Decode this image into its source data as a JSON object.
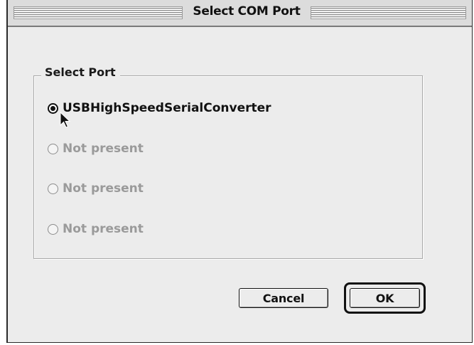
{
  "dialog": {
    "title": "Select COM Port"
  },
  "port_group": {
    "legend": "Select Port",
    "options": [
      {
        "label": "USBHighSpeedSerialConverter",
        "selected": true,
        "enabled": true
      },
      {
        "label": "Not present",
        "selected": false,
        "enabled": false
      },
      {
        "label": "Not present",
        "selected": false,
        "enabled": false
      },
      {
        "label": "Not present",
        "selected": false,
        "enabled": false
      }
    ]
  },
  "buttons": {
    "cancel_label": "Cancel",
    "ok_label": "OK"
  },
  "colors": {
    "window_bg": "#ececec",
    "text": "#111111",
    "disabled_text": "#9a9a9a"
  },
  "icons": {
    "cursor": "arrow-pointer-icon",
    "radio_selected": "radio-selected-icon",
    "radio_unselected": "radio-unselected-icon"
  }
}
